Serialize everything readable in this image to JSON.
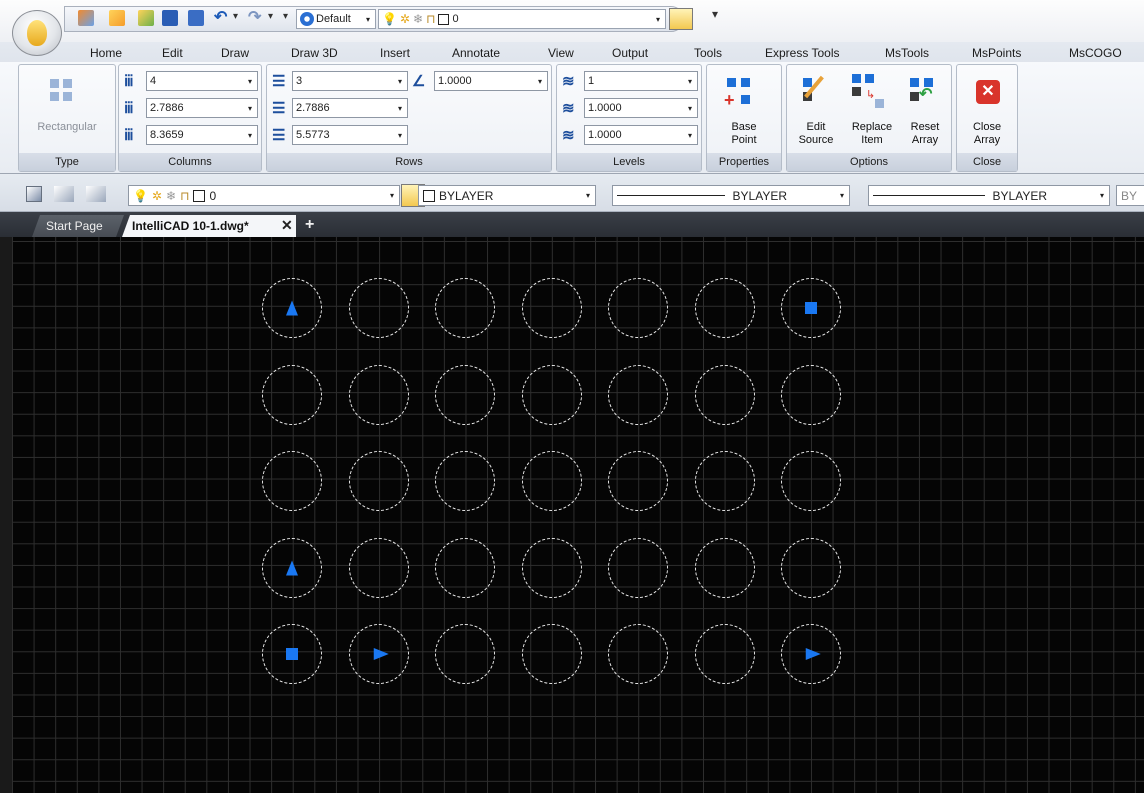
{
  "qat": {
    "workspace": "Default",
    "layer": "0"
  },
  "menu": [
    "Home",
    "Edit",
    "Draw",
    "Draw 3D",
    "Insert",
    "Annotate",
    "View",
    "Output",
    "Tools",
    "Express Tools",
    "MsTools",
    "MsPoints",
    "MsCOGO"
  ],
  "ribbon": {
    "type": {
      "button": "Rectangular",
      "title": "Type"
    },
    "columns": {
      "count": "4",
      "between": "2.7886",
      "total": "8.3659",
      "title": "Columns"
    },
    "rows": {
      "count": "3",
      "between": "2.7886",
      "total": "5.5773",
      "incremental": "1.0000",
      "title": "Rows"
    },
    "levels": {
      "count": "1",
      "between": "1.0000",
      "total": "1.0000",
      "title": "Levels"
    },
    "properties": {
      "base_point": "Base\nPoint",
      "title": "Properties"
    },
    "options": {
      "edit_source": "Edit\nSource",
      "replace_item": "Replace\nItem",
      "reset_array": "Reset\nArray",
      "title": "Options"
    },
    "close": {
      "close_array": "Close\nArray",
      "title": "Close"
    }
  },
  "propbar": {
    "layer": "0",
    "color": "BYLAYER",
    "linetype": "BYLAYER",
    "lineweight": "BYLAYER",
    "truncated": "BY"
  },
  "tabs": {
    "start": "Start Page",
    "active": "IntelliCAD 10-1.dwg*"
  },
  "colors": {
    "grip_blue": "#1a78f2",
    "close_red": "#d9342b"
  },
  "array": {
    "rows": 5,
    "columns": 7,
    "grips": {
      "0-0": "triangle-up",
      "0-6": "square",
      "3-0": "triangle-up",
      "4-0": "square",
      "4-1": "triangle-right",
      "4-6": "triangle-right"
    }
  }
}
